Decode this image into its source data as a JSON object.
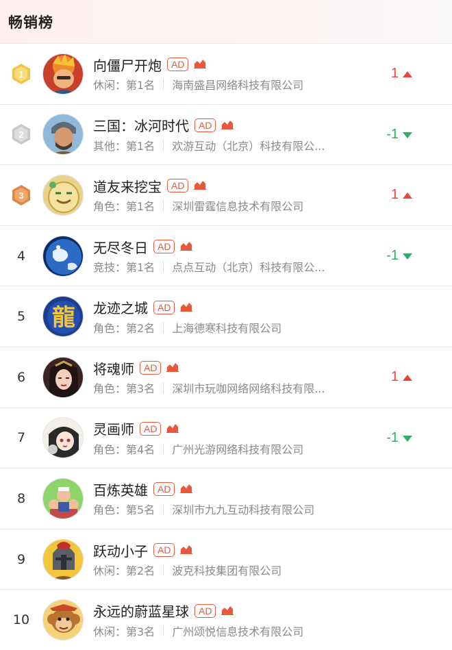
{
  "header": {
    "title": "畅销榜"
  },
  "ad_label": "AD",
  "colors": {
    "up": "#e8483b",
    "down": "#2fae6a",
    "ad": "#e8583b"
  },
  "items": [
    {
      "rank": "1",
      "medal": "gold",
      "name": "向僵尸开炮",
      "category": "休闲：第1名",
      "company": "海南盛昌网络科技有限公司",
      "change": "1",
      "direction": "up"
    },
    {
      "rank": "2",
      "medal": "silver",
      "name": "三国：冰河时代",
      "category": "其他：第1名",
      "company": "欢游互动（北京）科技有限公...",
      "change": "-1",
      "direction": "down"
    },
    {
      "rank": "3",
      "medal": "bronze",
      "name": "道友来挖宝",
      "category": "角色：第1名",
      "company": "深圳雷霆信息技术有限公司",
      "change": "1",
      "direction": "up"
    },
    {
      "rank": "4",
      "name": "无尽冬日",
      "category": "竞技：第1名",
      "company": "点点互动（北京）科技有限公...",
      "change": "-1",
      "direction": "down"
    },
    {
      "rank": "5",
      "name": "龙迹之城",
      "category": "角色：第2名",
      "company": "上海德寒科技有限公司",
      "change": "",
      "direction": ""
    },
    {
      "rank": "6",
      "name": "将魂师",
      "category": "角色：第3名",
      "company": "深圳市玩咖网络网络科技有限...",
      "change": "1",
      "direction": "up"
    },
    {
      "rank": "7",
      "name": "灵画师",
      "category": "角色：第4名",
      "company": "广州光游网络科技有限公司",
      "change": "-1",
      "direction": "down"
    },
    {
      "rank": "8",
      "name": "百炼英雄",
      "category": "角色：第5名",
      "company": "深圳市九九互动科技有限公司",
      "change": "",
      "direction": ""
    },
    {
      "rank": "9",
      "name": "跃动小子",
      "category": "休闲：第2名",
      "company": "波克科技集团有限公司",
      "change": "",
      "direction": ""
    },
    {
      "rank": "10",
      "name": "永远的蔚蓝星球",
      "category": "休闲：第3名",
      "company": "广州颂悦信息技术有限公司",
      "change": "",
      "direction": ""
    }
  ]
}
